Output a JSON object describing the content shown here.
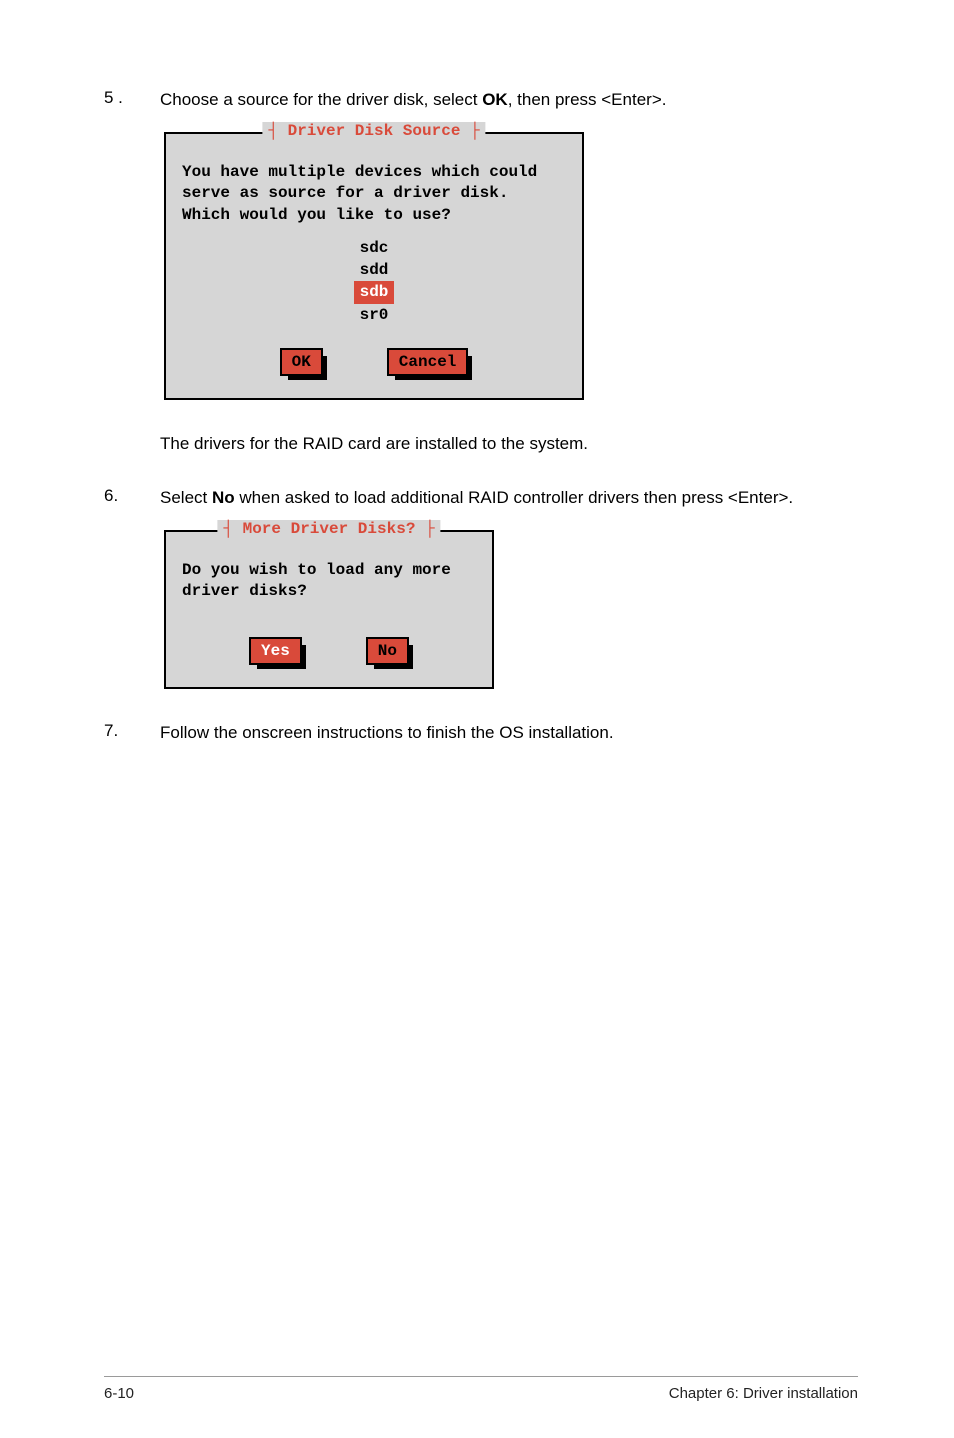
{
  "step5": {
    "num": "5 .",
    "text_a": "Choose a source for the driver disk, select ",
    "text_b": "OK",
    "text_c": ", then press <Enter>."
  },
  "dlg1": {
    "title": "Driver Disk Source",
    "body": "You have multiple devices which could serve as source for a driver disk. Which would you like to use?",
    "opts": [
      "sdc",
      "sdd",
      "sdb",
      "sr0"
    ],
    "selected": 2,
    "ok": "OK",
    "cancel": "Cancel"
  },
  "mid_text": "The drivers for the RAID card are installed to the system.",
  "step6": {
    "num": "6.",
    "text_a": "Select ",
    "text_b": "No",
    "text_c": " when asked to load additional RAID controller drivers then press <Enter>."
  },
  "dlg2": {
    "title": "More Driver Disks?",
    "body": "Do you wish to load any more driver disks?",
    "yes": "Yes",
    "no": "No"
  },
  "step7": {
    "num": "7.",
    "text": "Follow the onscreen instructions to finish the OS installation."
  },
  "footer": {
    "left": "6-10",
    "right": "Chapter 6: Driver installation"
  }
}
